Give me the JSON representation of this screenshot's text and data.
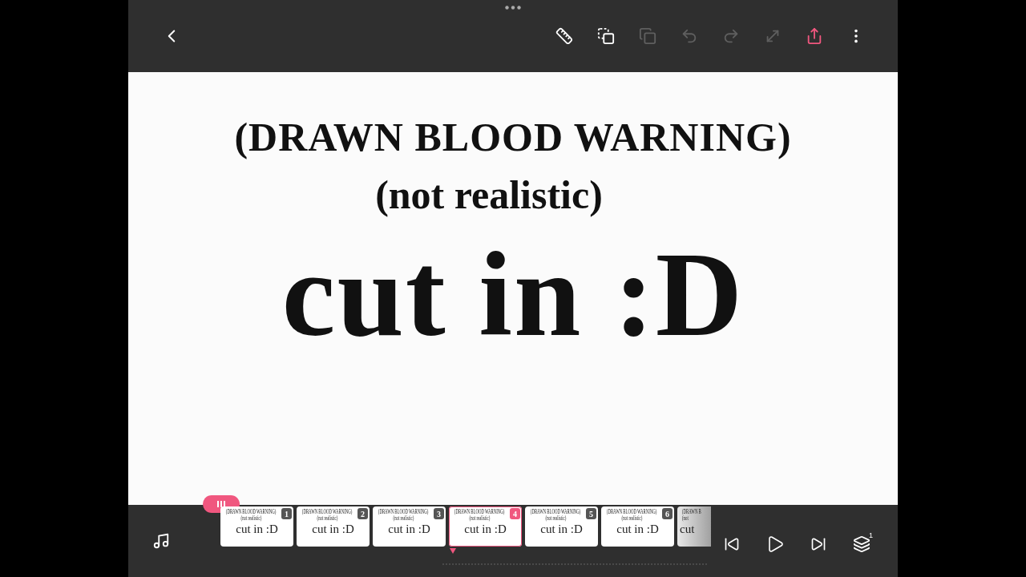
{
  "toolbar": {
    "tools": [
      {
        "kind": "ruler",
        "disabled": false
      },
      {
        "kind": "select-copy",
        "disabled": false
      },
      {
        "kind": "copy",
        "disabled": true
      },
      {
        "kind": "undo",
        "disabled": true
      },
      {
        "kind": "redo",
        "disabled": true
      },
      {
        "kind": "resize",
        "disabled": true
      },
      {
        "kind": "share",
        "disabled": false
      },
      {
        "kind": "more",
        "disabled": false
      }
    ]
  },
  "canvas": {
    "lines": [
      {
        "text": "(DRAWN BLOOD WARNING)",
        "kind": "title"
      },
      {
        "text": "(not realistic)",
        "kind": "subtitle"
      },
      {
        "text": "cut in :D",
        "kind": "big"
      }
    ]
  },
  "timeline": {
    "layer_count": "1",
    "frames": [
      {
        "number": "1",
        "selected": false,
        "lines": [
          "(DRAWN BLOOD WARNING)",
          "(not realistic)",
          "cut in :D"
        ]
      },
      {
        "number": "2",
        "selected": false,
        "lines": [
          "(DRAWN BLOOD WARNING)",
          "(not realistic)",
          "cut in :D"
        ]
      },
      {
        "number": "3",
        "selected": false,
        "lines": [
          "(DRAWN BLOOD WARNING)",
          "(not realistic)",
          "cut in :D"
        ]
      },
      {
        "number": "4",
        "selected": true,
        "lines": [
          "(DRAWN BLOOD WARNING)",
          "(not realistic)",
          "cut in :D"
        ]
      },
      {
        "number": "5",
        "selected": false,
        "lines": [
          "(DRAWN BLOOD WARNING)",
          "(not realistic)",
          "cut in :D"
        ]
      },
      {
        "number": "6",
        "selected": false,
        "lines": [
          "(DRAWN BLOOD WARNING)",
          "(not realistic)",
          "cut in :D"
        ]
      },
      {
        "selected": false,
        "lines": [
          "(DRAWN B",
          "(not",
          "cut"
        ]
      }
    ]
  }
}
